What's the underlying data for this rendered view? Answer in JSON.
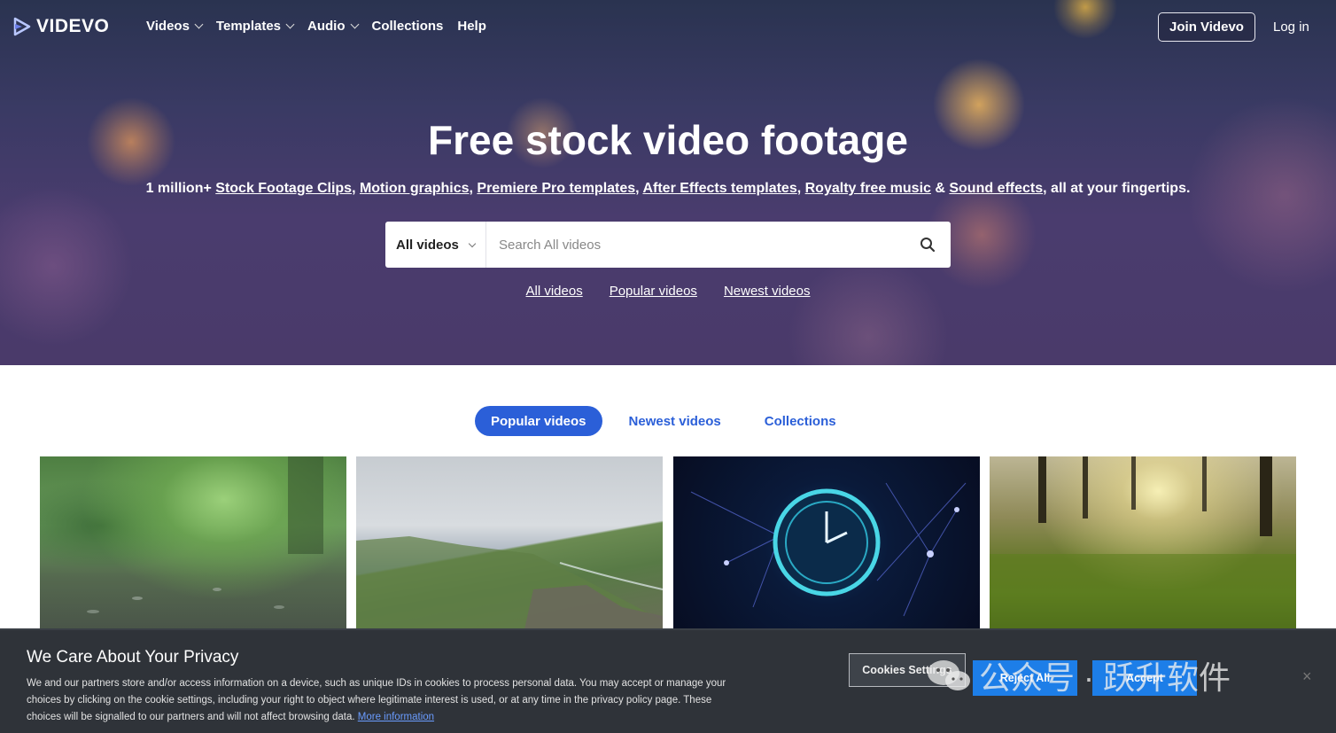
{
  "brand": {
    "name": "VIDEVO"
  },
  "nav": {
    "items": [
      {
        "label": "Videos",
        "has_dropdown": true
      },
      {
        "label": "Templates",
        "has_dropdown": true
      },
      {
        "label": "Audio",
        "has_dropdown": true
      },
      {
        "label": "Collections",
        "has_dropdown": false
      },
      {
        "label": "Help",
        "has_dropdown": false
      }
    ],
    "join_label": "Join Videvo",
    "login_label": "Log in"
  },
  "hero": {
    "title": "Free stock video footage",
    "subtitle": {
      "prefix": "1 million+ ",
      "links": [
        "Stock Footage Clips",
        "Motion graphics",
        "Premiere Pro templates",
        "After Effects templates",
        "Royalty free music",
        "Sound effects"
      ],
      "amp": " & ",
      "suffix": ", all at your fingertips."
    }
  },
  "search": {
    "category": "All videos",
    "placeholder": "Search All videos",
    "icon": "search-icon"
  },
  "quick_links": [
    "All videos",
    "Popular videos",
    "Newest videos"
  ],
  "tabs": [
    {
      "label": "Popular videos",
      "active": true
    },
    {
      "label": "Newest videos",
      "active": false
    },
    {
      "label": "Collections",
      "active": false
    }
  ],
  "thumbnails": [
    {
      "subject": "rain on forest ground"
    },
    {
      "subject": "rocky ocean coastline"
    },
    {
      "subject": "glowing clock with network lines"
    },
    {
      "subject": "sunlit forest grass"
    }
  ],
  "cookie": {
    "title": "We Care About Your Privacy",
    "text": "We and our partners store and/or access information on a device, such as unique IDs in cookies to process personal data. You may accept or manage your choices by clicking on the cookie settings, including your right to object where legitimate interest is used, or at any time in the privacy policy page. These choices will be signalled to our partners and will not affect browsing data.",
    "more_link": "More information",
    "settings_label": "Cookies Settings",
    "reject_label": "Reject All",
    "accept_label": "Accept",
    "close": "×"
  },
  "watermark": {
    "text": "公众号 · 跃升软件"
  },
  "colors": {
    "accent": "#2b5fd8",
    "button_blue": "#1d7ee8",
    "cookie_bg": "#2f3339"
  }
}
